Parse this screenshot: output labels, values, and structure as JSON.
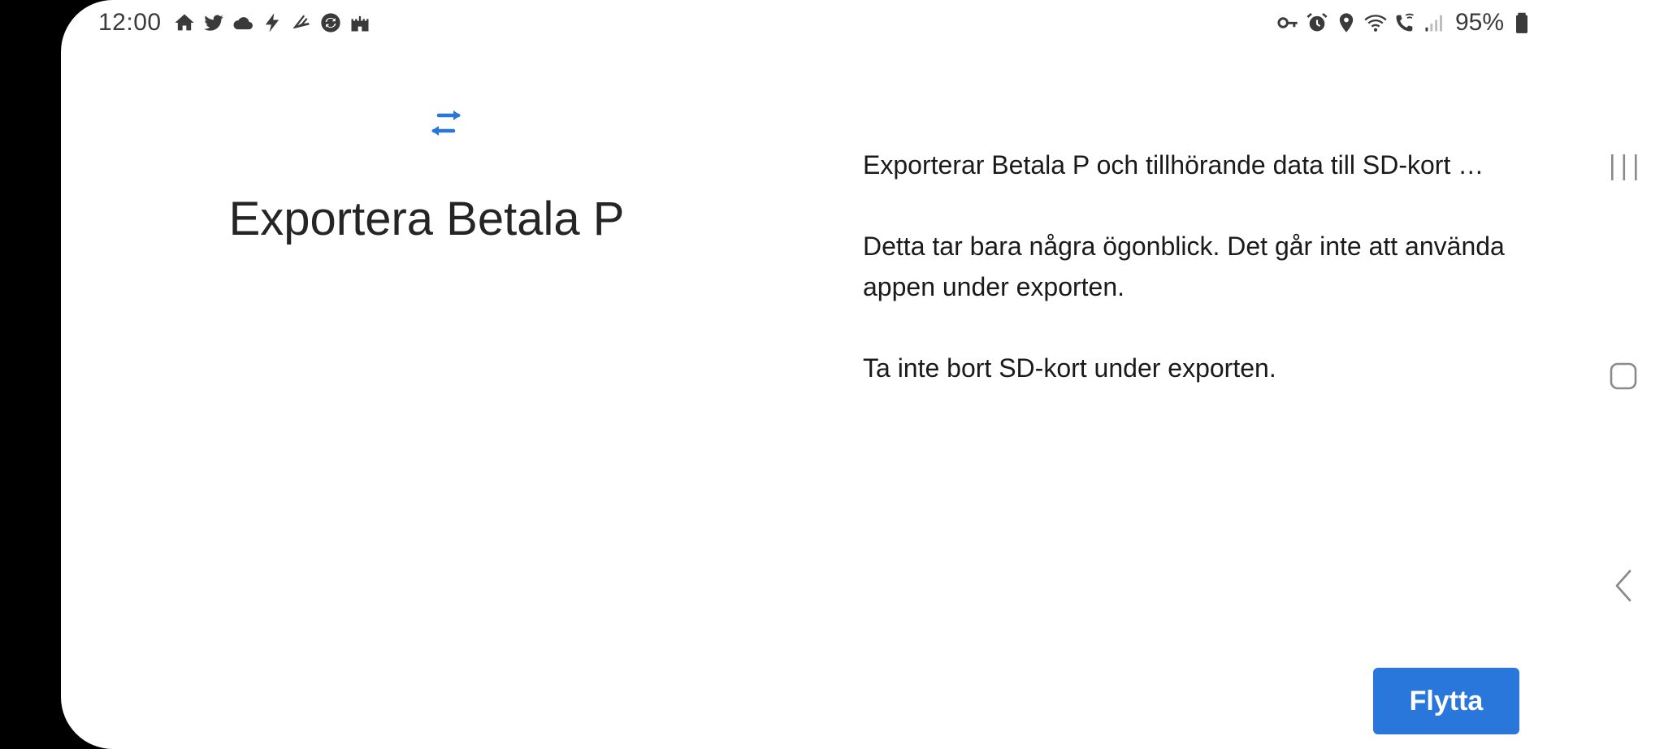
{
  "status_bar": {
    "time": "12:00",
    "left_icons": [
      "home-icon",
      "twitter-icon",
      "cloud-icon",
      "bolt-icon",
      "shoe-icon",
      "sync-icon",
      "castle-icon"
    ],
    "right_icons": [
      "key-icon",
      "alarm-icon",
      "location-icon",
      "wifi-icon",
      "wifi-calling-icon",
      "signal-icon"
    ],
    "battery_percent": "95%"
  },
  "main": {
    "icon": "swap-arrows-icon",
    "title": "Exportera Betala P",
    "paragraphs": [
      "Exporterar Betala P och tillhörande data till SD-kort …",
      "Detta tar bara några ögonblick. Det går inte att använda appen under exporten.",
      "Ta inte bort SD-kort under exporten."
    ],
    "button_label": "Flytta"
  },
  "colors": {
    "accent": "#2a77db",
    "text": "#1a1a1a",
    "background": "#ffffff"
  },
  "nav_bar": {
    "items": [
      "recents-icon",
      "home-button-icon",
      "back-icon"
    ]
  }
}
